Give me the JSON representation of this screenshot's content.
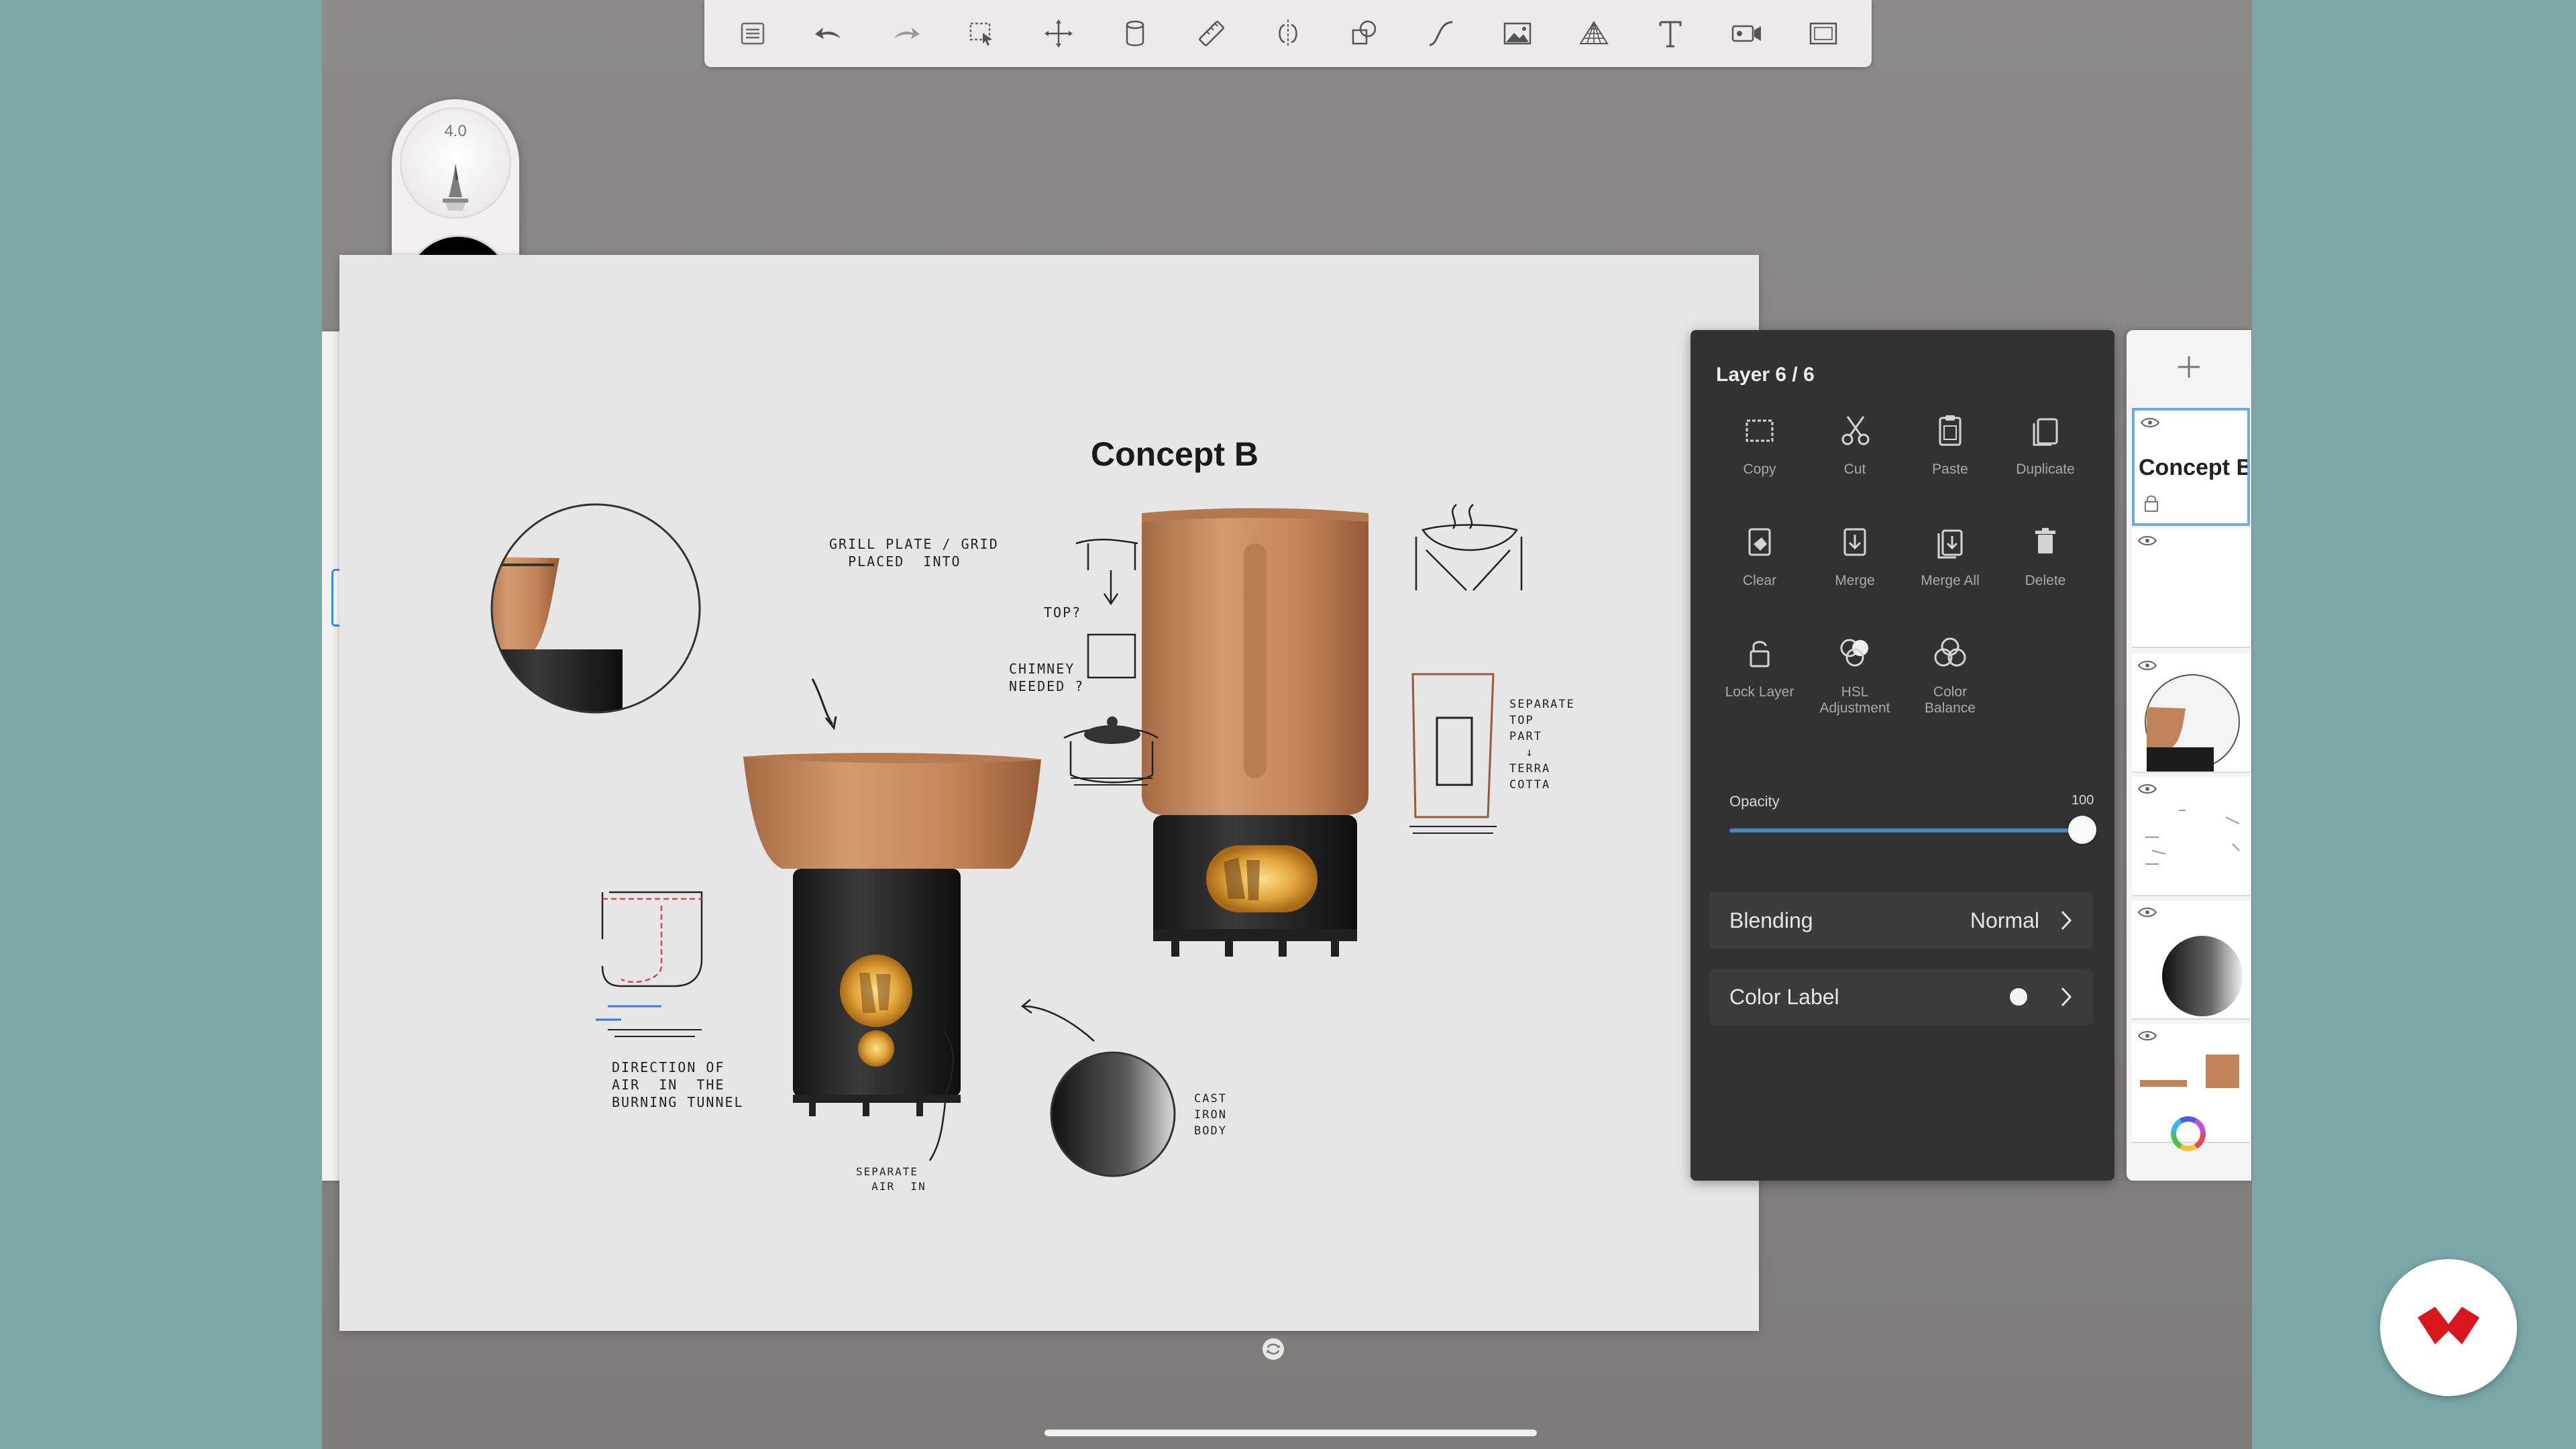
{
  "toolbar": {
    "items": [
      "list-icon",
      "undo-icon",
      "redo-icon",
      "selection-icon",
      "transform-icon",
      "fill-icon",
      "ruler-icon",
      "symmetry-icon",
      "shapes-icon",
      "curve-icon",
      "image-icon",
      "perspective-icon",
      "text-icon",
      "video-icon",
      "fullscreen-icon"
    ]
  },
  "brush_puck": {
    "size": "4.0",
    "color": "#000000"
  },
  "brushes": [
    "brush-1",
    "brush-2",
    "brush-3",
    "brush-4",
    "brush-5",
    "brush-6",
    "brush-7",
    "brush-8",
    "brush-9",
    "brush-10",
    "brush-11"
  ],
  "canvas": {
    "title": "Concept B",
    "notes": {
      "grill": "GRILL PLATE / GRID\n  PLACED  INTO",
      "top": "TOP?",
      "chimney": "CHIMNEY\nNEEDED ?",
      "separate_top": "SEPARATE\nTOP\nPART\n  ↓\nTERRA\nCOTTA",
      "direction": "DIRECTION OF\nAIR  IN  THE\nBURNING TUNNEL",
      "separate_air": "SEPARATE\n  AIR  IN",
      "cast_iron": "CAST\nIRON\nBODY"
    }
  },
  "layer_panel": {
    "title": "Layer 6 / 6",
    "actions": [
      {
        "label": "Copy",
        "icon": "copy-icon"
      },
      {
        "label": "Cut",
        "icon": "scissors-icon"
      },
      {
        "label": "Paste",
        "icon": "paste-icon"
      },
      {
        "label": "Duplicate",
        "icon": "duplicate-icon"
      },
      {
        "label": "Clear",
        "icon": "clear-icon"
      },
      {
        "label": "Merge",
        "icon": "merge-icon"
      },
      {
        "label": "Merge All",
        "icon": "merge-all-icon"
      },
      {
        "label": "Delete",
        "icon": "trash-icon"
      },
      {
        "label": "Lock Layer",
        "icon": "lock-icon"
      },
      {
        "label": "HSL\nAdjustment",
        "icon": "hsl-icon"
      },
      {
        "label": "Color\nBalance",
        "icon": "color-balance-icon"
      }
    ],
    "opacity_label": "Opacity",
    "opacity_value": "100",
    "opacity_fraction": 1.0,
    "blending_label": "Blending",
    "blending_value": "Normal",
    "color_label": "Color Label",
    "color_label_color": "#f3f3f3"
  },
  "layers": {
    "selected_name": "Concept B",
    "count": 6
  },
  "colors": {
    "copper": "#c0835a",
    "accent_blue": "#3d8be8",
    "brand_red": "#d8161b"
  }
}
